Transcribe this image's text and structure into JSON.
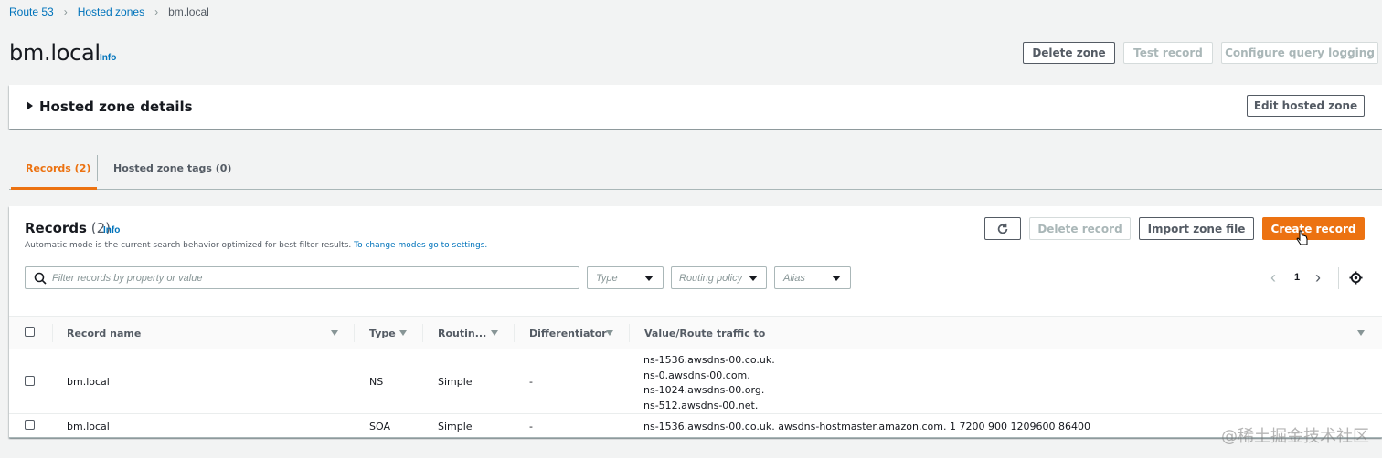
{
  "breadcrumb": {
    "root": "Route 53",
    "parent": "Hosted zones",
    "current": "bm.local"
  },
  "page": {
    "title": "bm.local",
    "info": "Info"
  },
  "header_actions": {
    "delete_zone": "Delete zone",
    "test_record": "Test record",
    "configure_logging": "Configure query logging"
  },
  "details": {
    "title": "Hosted zone details",
    "edit": "Edit hosted zone"
  },
  "tabs": [
    {
      "label": "Records (2)",
      "active": true
    },
    {
      "label": "Hosted zone tags (0)",
      "active": false
    }
  ],
  "records": {
    "title": "Records",
    "count": "(2)",
    "info": "Info",
    "description": "Automatic mode is the current search behavior optimized for best filter results.",
    "description_link": "To change modes go to settings.",
    "delete": "Delete record",
    "import": "Import zone file",
    "create": "Create record",
    "search_placeholder": "Filter records by property or value",
    "filters": {
      "type": "Type",
      "routing": "Routing policy",
      "alias": "Alias"
    },
    "page": "1"
  },
  "table": {
    "columns": [
      "Record name",
      "Type",
      "Routin...",
      "Differentiator",
      "Value/Route traffic to"
    ],
    "rows": [
      {
        "name": "bm.local",
        "type": "NS",
        "routing": "Simple",
        "diff": "-",
        "values": [
          "ns-1536.awsdns-00.co.uk.",
          "ns-0.awsdns-00.com.",
          "ns-1024.awsdns-00.org.",
          "ns-512.awsdns-00.net."
        ]
      },
      {
        "name": "bm.local",
        "type": "SOA",
        "routing": "Simple",
        "diff": "-",
        "values": [
          "ns-1536.awsdns-00.co.uk. awsdns-hostmaster.amazon.com. 1 7200 900 1209600 86400"
        ]
      }
    ]
  },
  "watermark": "@稀土掘金技术社区",
  "colors": {
    "link": "#0073bb",
    "primary": "#ec7211",
    "active_tab": "#ec7211"
  }
}
